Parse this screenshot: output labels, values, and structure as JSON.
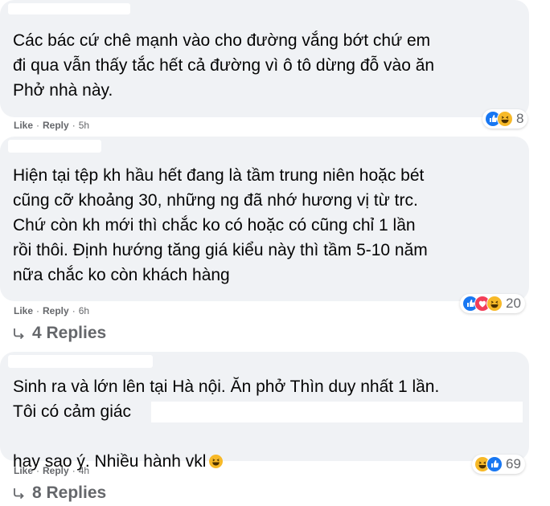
{
  "comments": [
    {
      "text": "Các bác cứ chê mạnh vào cho đường vắng bớt chứ em\nđi qua vẫn thấy tắc hết cả đường vì ô tô dừng đỗ vào ăn\nPhở nhà này.",
      "like_label": "Like",
      "reply_label": "Reply",
      "time": "5h",
      "reactions": [
        "like-icon",
        "haha-icon"
      ],
      "reaction_count": "8"
    },
    {
      "text": "Hiện tại tệp kh hầu hết đang là tầm trung niên hoặc bét\ncũng cỡ khoảng 30, những ng đã nhớ hương vị từ trc.\nChứ còn kh mới thì chắc ko có hoặc có cũng chỉ 1 lần\nrồi thôi. Định hướng tăng giá kiểu này thì tầm 5-10 năm\nnữa chắc ko còn khách hàng",
      "like_label": "Like",
      "reply_label": "Reply",
      "time": "6h",
      "reactions": [
        "like-icon",
        "love-icon",
        "haha-icon"
      ],
      "reaction_count": "20",
      "replies_label": "4 Replies"
    },
    {
      "text_line1": "Sinh ra và lớn lên tại Hà nội. Ăn phở Thìn duy nhất 1 lần.",
      "text_line2": "Tôi có cảm giác",
      "text_line3": "hay sao ý. Nhiều hành vkl",
      "like_label": "Like",
      "reply_label": "Reply",
      "time": "4h",
      "reactions": [
        "haha-icon",
        "like-icon"
      ],
      "reaction_count": "69",
      "replies_label": "8 Replies"
    }
  ],
  "colors": {
    "bubble": "#f0f2f5",
    "meta_text": "#65676b",
    "like_blue": "#1877f2",
    "love_red": "#f33e58",
    "haha_yellow": "#f7b928"
  }
}
